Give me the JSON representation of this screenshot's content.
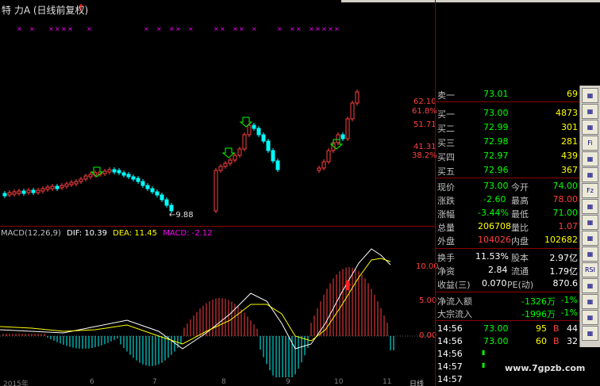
{
  "title": {
    "stock_name": "特 力A (日线前复权)",
    "arrow": "↑"
  },
  "price_labels": {
    "p1": "62.10",
    "p2": "61.8%",
    "p3": "51.71",
    "p4": "41.31",
    "p5": "38.2%",
    "low_marker": "←9.88"
  },
  "macd": {
    "name": "MACD(12,26,9)",
    "dif": "DIF: 10.39",
    "dea": "DEA: 11.45",
    "macd": "MACD: -2.12",
    "axis": [
      "10.00",
      "5.00",
      "0.00"
    ]
  },
  "date_axis": [
    "2015年",
    "6",
    "7",
    "8",
    "9",
    "10",
    "11",
    "日线"
  ],
  "quote": {
    "sell1": {
      "label": "卖一",
      "price": "73.01",
      "vol": "69"
    },
    "buy1": {
      "label": "买一",
      "price": "73.00",
      "vol": "4873"
    },
    "buy2": {
      "label": "买二",
      "price": "72.99",
      "vol": "301"
    },
    "buy3": {
      "label": "买三",
      "price": "72.98",
      "vol": "281"
    },
    "buy4": {
      "label": "买四",
      "price": "72.97",
      "vol": "439"
    },
    "buy5": {
      "label": "买五",
      "price": "72.96",
      "vol": "367"
    },
    "xianjia": {
      "label": "现价",
      "value": "73.00",
      "label2": "今开",
      "value2": "74.00"
    },
    "zhangdie": {
      "label": "涨跌",
      "value": "-2.60",
      "label2": "最高",
      "value2": "78.00"
    },
    "zhangfu": {
      "label": "涨幅",
      "value": "-3.44%",
      "label2": "最低",
      "value2": "71.00"
    },
    "zongliang": {
      "label": "总量",
      "value": "206708",
      "label2": "量比",
      "value2": "1.07"
    },
    "waipan": {
      "label": "外盘",
      "value": "104026",
      "label2": "内盘",
      "value2": "102682"
    },
    "huanshou": {
      "label": "换手",
      "value": "11.53%",
      "label2": "股本",
      "value2": "2.97亿"
    },
    "jingzi": {
      "label": "净资",
      "value": "2.84",
      "label2": "流通",
      "value2": "1.79亿"
    },
    "shouyi": {
      "label": "收益(三)",
      "value": "0.070",
      "label2": "PE(动)",
      "value2": "870.6"
    },
    "jingliuru": {
      "label": "净流入额",
      "value": "-1326万",
      "pct": "-1%"
    },
    "dazong": {
      "label": "大宗流入",
      "value": "-1996万",
      "pct": "-1%"
    }
  },
  "ticks": [
    {
      "time": "14:56",
      "price": "73.00",
      "vol": "95",
      "dir": "B",
      "num": "44"
    },
    {
      "time": "14:56",
      "price": "73.00",
      "vol": "60",
      "dir": "B",
      "num": "32"
    },
    {
      "time": "14:56",
      "price": "",
      "vol": "",
      "dir": "",
      "num": ""
    },
    {
      "time": "14:57",
      "price": "",
      "vol": "",
      "dir": "",
      "num": ""
    },
    {
      "time": "14:57",
      "price": "",
      "vol": "",
      "dir": "",
      "num": ""
    }
  ],
  "toolbar": [
    "",
    "",
    "",
    "Fi",
    "",
    "",
    "Fz",
    "",
    "",
    "",
    "",
    "RSI",
    "",
    "",
    "",
    ""
  ],
  "watermark": "www.7gpzb.com",
  "colors": {
    "up": "#ff4040",
    "down": "#00ffff",
    "dif": "#ffffff",
    "dea": "#ffff00",
    "macd": "#ff00ff",
    "grid": "#8b0000"
  }
}
